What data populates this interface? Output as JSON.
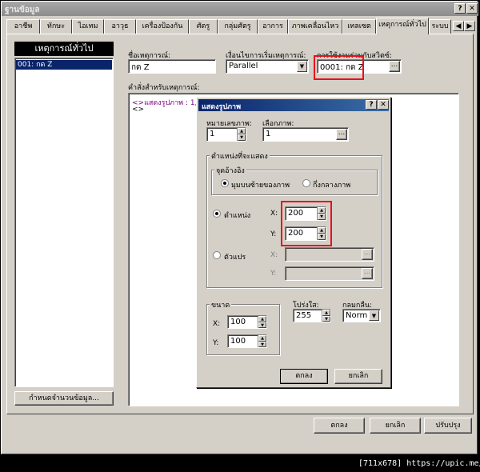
{
  "window": {
    "title": "ฐานข้อมูล",
    "help": "?",
    "close": "✕"
  },
  "tabs": [
    "อาชีพ",
    "ทักษะ",
    "ไอเทม",
    "อาวุธ",
    "เครื่องป้องกัน",
    "ศัตรู",
    "กลุ่มศัตรู",
    "อาการ",
    "ภาพเคลื่อนไหว",
    "เทลเซต",
    "เหตุการณ์ทั่วไป",
    "ระบบ"
  ],
  "tab_scroll": {
    "left": "◀",
    "right": "▶"
  },
  "left_panel": {
    "header": "เหตุการณ์ทั่วไป",
    "items": [
      "001: กด Z"
    ],
    "max_button": "กำหนดจำนวนข้อมูล..."
  },
  "event": {
    "name_label": "ชื่อเหตุการณ์:",
    "name_value": "กด Z",
    "trigger_label": "เงื่อนไขการเริ่มเหตุการณ์:",
    "trigger_value": "Parallel",
    "switch_label": "การใช้งานร่วมกับสวิตซ์:",
    "switch_value": "0001: กด Z",
    "commands_label": "คำสั่งสำหรับเหตุการณ์:",
    "commands": [
      "<>แสดงรูปภาพ : 1, '' ",
      "<>"
    ]
  },
  "main_buttons": {
    "ok": "ตกลง",
    "cancel": "ยกเลิก",
    "apply": "ปรับปรุง"
  },
  "dialog": {
    "title": "แสดงรูปภาพ",
    "help": "?",
    "close": "✕",
    "number_label": "หมายเลขภาพ:",
    "number_value": "1",
    "graphic_label": "เลือกภาพ:",
    "graphic_value": "1",
    "position_group": "ตำแหน่งที่จะแสดง",
    "origin_group": "จุดอ้างอิง",
    "origin_upper_left": "มุมบนซ้ายของภาพ",
    "origin_center": "กึ่งกลางภาพ",
    "direct_label": "ตำแหน่ง",
    "x_label": "X:",
    "y_label": "Y:",
    "x_value": "200",
    "y_value": "200",
    "variable_label": "ตัวแปร",
    "var_x": "",
    "var_y": "",
    "zoom_group": "ขนาด",
    "zoom_x": "100",
    "zoom_y": "100",
    "opacity_label": "โปร่งใส:",
    "opacity_value": "255",
    "blend_label": "กลมกลืน:",
    "blend_value": "Norm",
    "ok": "ตกลง",
    "cancel": "ยกเลิก"
  },
  "watermark": "[711x678] https://upic.me/"
}
